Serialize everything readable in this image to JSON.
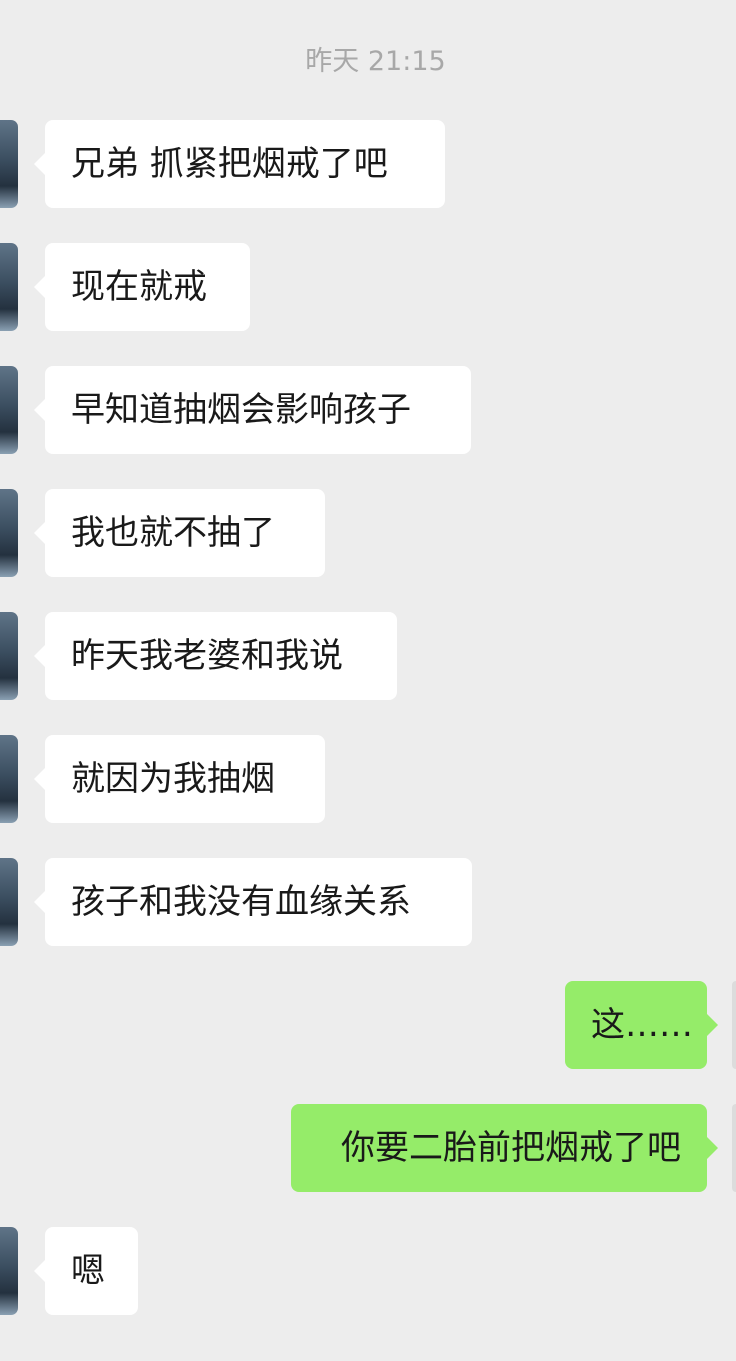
{
  "chat": {
    "timestamp": "昨天 21:15",
    "messages": [
      {
        "direction": "in",
        "text": "兄弟 抓紧把烟戒了吧"
      },
      {
        "direction": "in",
        "text": "现在就戒"
      },
      {
        "direction": "in",
        "text": "早知道抽烟会影响孩子"
      },
      {
        "direction": "in",
        "text": "我也就不抽了"
      },
      {
        "direction": "in",
        "text": "昨天我老婆和我说"
      },
      {
        "direction": "in",
        "text": "就因为我抽烟"
      },
      {
        "direction": "in",
        "text": "孩子和我没有血缘关系"
      },
      {
        "direction": "out",
        "text": "这……"
      },
      {
        "direction": "out",
        "text": "你要二胎前把烟戒了吧"
      },
      {
        "direction": "in",
        "text": "嗯"
      }
    ]
  },
  "colors": {
    "background": "#ededed",
    "incoming_bubble": "#ffffff",
    "outgoing_bubble": "#95ec69",
    "timestamp_text": "#a8a8a8"
  }
}
